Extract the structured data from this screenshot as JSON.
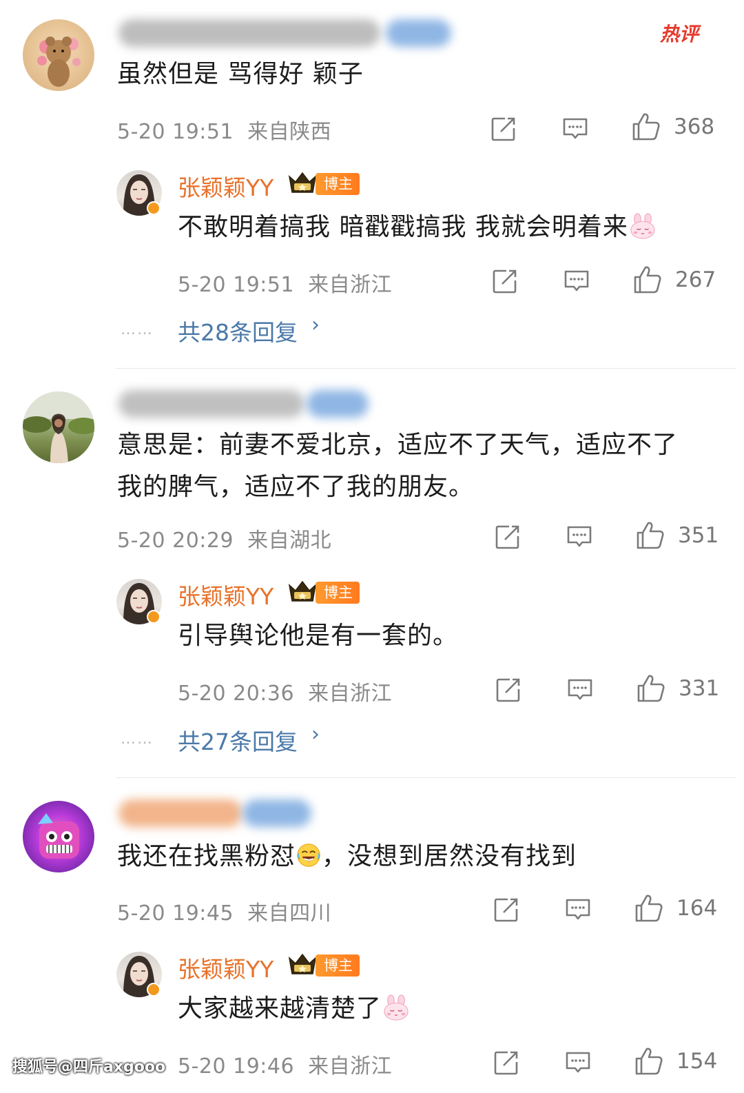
{
  "hot_tag": "热评",
  "comments": [
    {
      "text": "虽然但是 骂得好 颖子",
      "time": "5-20 19:51",
      "location": "来自陕西",
      "likes": "368",
      "reply": {
        "username": "张颖颖YY",
        "badge": "博主",
        "text": "不敢明着搞我 暗戳戳搞我 我就会明着来",
        "time": "5-20 19:51",
        "location": "来自浙江",
        "likes": "267"
      },
      "more_dots": "……",
      "more_replies": "共28条回复",
      "more_arrow": "›"
    },
    {
      "text_line1": "意思是：前妻不爱北京，适应不了天气，适应不了",
      "text_line2": "我的脾气，适应不了我的朋友。",
      "time": "5-20 20:29",
      "location": "来自湖北",
      "likes": "351",
      "reply": {
        "username": "张颖颖YY",
        "badge": "博主",
        "text": "引导舆论他是有一套的。",
        "time": "5-20 20:36",
        "location": "来自浙江",
        "likes": "331"
      },
      "more_dots": "……",
      "more_replies": "共27条回复",
      "more_arrow": "›"
    },
    {
      "text_before": "我还在找黑粉怼",
      "text_after": "，没想到居然没有找到",
      "time": "5-20 19:45",
      "location": "来自四川",
      "likes": "164",
      "reply": {
        "username": "张颖颖YY",
        "badge": "博主",
        "text": "大家越来越清楚了",
        "time": "5-20 19:46",
        "location": "来自浙江",
        "likes": "154"
      }
    }
  ],
  "watermark": "搜狐号@四斤axgooo",
  "icons": [
    "share-icon",
    "comment-icon",
    "like-icon",
    "crown-icon",
    "bunny-emoji-icon",
    "laugh-cry-emoji-icon"
  ],
  "colors": {
    "username": "#e8722a",
    "link": "#4b79a8",
    "meta": "#8a8a8a",
    "badge": "#ff8a25",
    "hot": "#e63a2e"
  }
}
